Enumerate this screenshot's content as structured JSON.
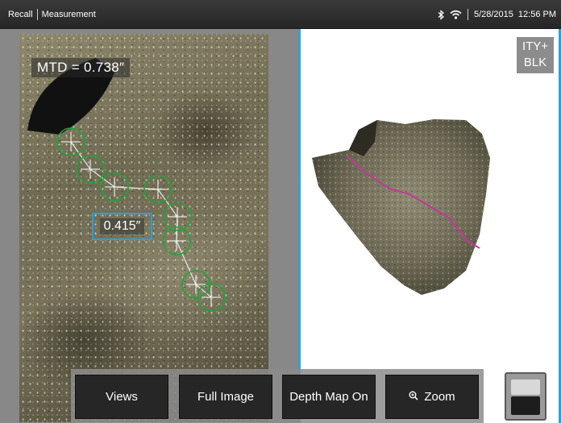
{
  "status_bar": {
    "mode": "Recall",
    "submode": "Measurement",
    "date": "5/28/2015",
    "time": "12:56 PM",
    "icons": [
      "bluetooth-icon",
      "wifi-icon"
    ]
  },
  "left_view": {
    "mtd_label": "MTD = 0.738″",
    "measurement_value": "0.415″",
    "cursor_color": "#1fa53a",
    "box_color": "#2a9fd8"
  },
  "right_view": {
    "mode_badge_line1": "ITY+",
    "mode_badge_line2": "BLK",
    "profile_color": "#c0399c",
    "border_color": "#2aa3dc"
  },
  "toolbar": {
    "views_label": "Views",
    "full_image_label": "Full Image",
    "depth_map_label": "Depth Map On",
    "zoom_label": "Zoom"
  }
}
